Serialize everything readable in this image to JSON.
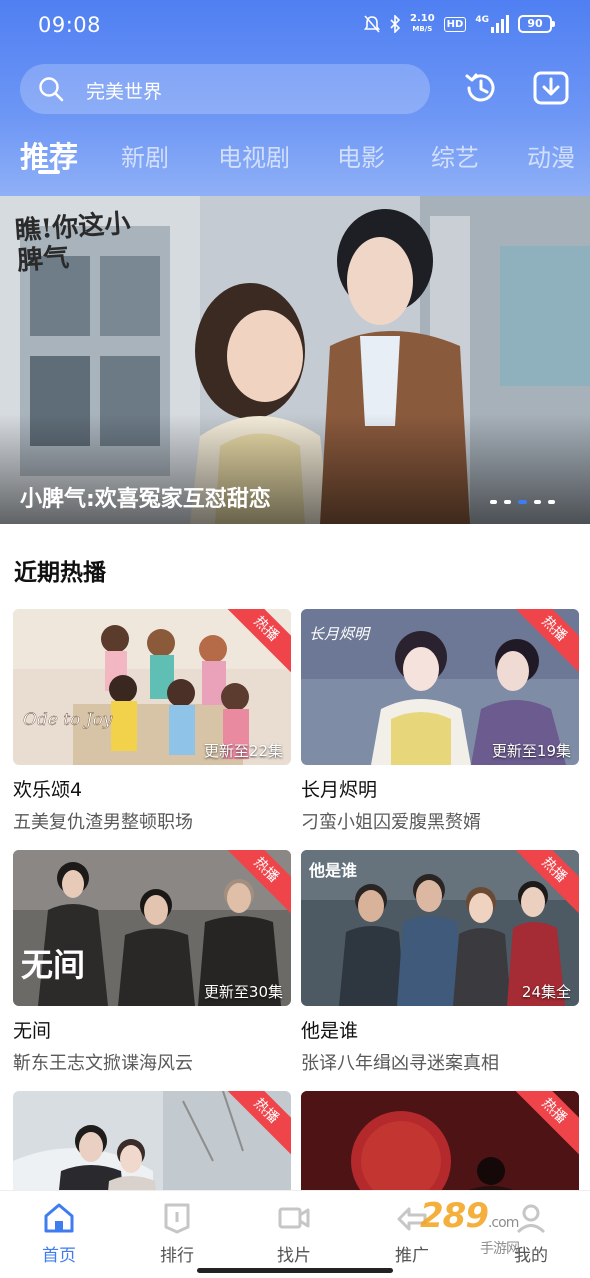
{
  "status_bar": {
    "time": "09:08",
    "net_speed": "2.10",
    "net_unit": "MB/S",
    "hd": "HD",
    "signal": "4G",
    "battery": "90"
  },
  "search": {
    "text": "完美世界"
  },
  "tabs": [
    "推荐",
    "新剧",
    "电视剧",
    "电影",
    "综艺",
    "动漫"
  ],
  "banner": {
    "caption": "小脾气:欢喜冤家互怼甜恋",
    "logo_text": "瞧!你这小脾气",
    "slides": 5,
    "active_slide": 3
  },
  "section": {
    "title": "近期热播"
  },
  "cards": [
    {
      "title": "欢乐颂4",
      "desc": "五美复仇渣男整顿职场",
      "badge": "热播",
      "episode": "更新至22集",
      "poster_text": "Ode to Joy"
    },
    {
      "title": "长月烬明",
      "desc": "刁蛮小姐囚爱腹黑赘婿",
      "badge": "热播",
      "episode": "更新至19集",
      "poster_text": "长月烬明"
    },
    {
      "title": "无间",
      "desc": "靳东王志文掀谍海风云",
      "badge": "热播",
      "episode": "更新至30集",
      "poster_text": "无间"
    },
    {
      "title": "他是谁",
      "desc": "张译八年缉凶寻迷案真相",
      "badge": "热播",
      "episode": "24集全",
      "poster_text": "他是谁"
    },
    {
      "badge": "热播"
    },
    {
      "badge": "热播"
    }
  ],
  "bottom_nav": [
    {
      "label": "首页",
      "icon": "home-icon",
      "active": true
    },
    {
      "label": "排行",
      "icon": "ranking-icon"
    },
    {
      "label": "找片",
      "icon": "video-icon"
    },
    {
      "label": "推广",
      "icon": "promote-icon"
    },
    {
      "label": "我的",
      "icon": "profile-icon"
    }
  ],
  "watermark": {
    "brand": "289",
    "suffix": ".com",
    "sub": "手游网"
  },
  "colors": {
    "accent": "#3f7cf0",
    "header_top": "#4f7ff2",
    "hot_badge": "#f0444b"
  }
}
